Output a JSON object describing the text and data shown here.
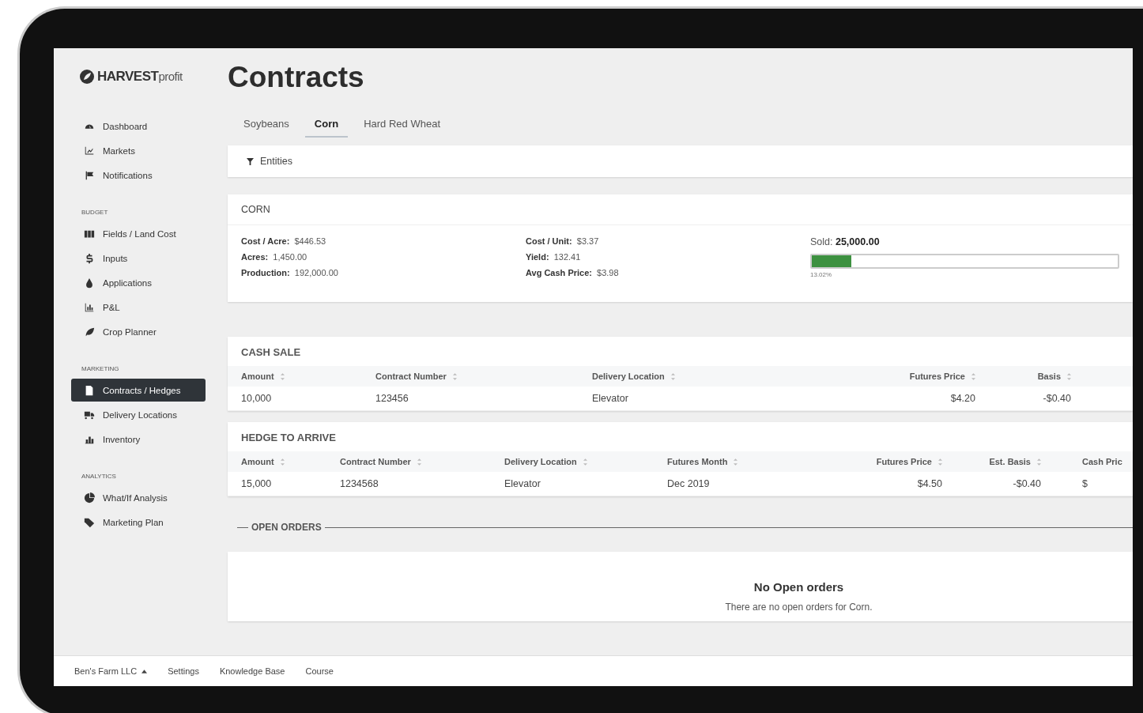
{
  "logo": {
    "brand": "HARVEST",
    "suffix": "profit"
  },
  "page_title": "Contracts",
  "sidebar": {
    "groups": [
      {
        "items": [
          {
            "label": "Dashboard",
            "selected": false
          },
          {
            "label": "Markets",
            "selected": false
          },
          {
            "label": "Notifications",
            "selected": false
          }
        ]
      },
      {
        "heading": "BUDGET",
        "items": [
          {
            "label": "Fields / Land Cost",
            "selected": false
          },
          {
            "label": "Inputs",
            "selected": false
          },
          {
            "label": "Applications",
            "selected": false
          },
          {
            "label": "P&L",
            "selected": false
          },
          {
            "label": "Crop Planner",
            "selected": false
          }
        ]
      },
      {
        "heading": "MARKETING",
        "items": [
          {
            "label": "Contracts / Hedges",
            "selected": true
          },
          {
            "label": "Delivery Locations",
            "selected": false
          },
          {
            "label": "Inventory",
            "selected": false
          }
        ]
      },
      {
        "heading": "ANALYTICS",
        "items": [
          {
            "label": "What/If Analysis",
            "selected": false
          },
          {
            "label": "Marketing Plan",
            "selected": false
          }
        ]
      }
    ]
  },
  "tabs": [
    {
      "label": "Soybeans",
      "selected": false
    },
    {
      "label": "Corn",
      "selected": true
    },
    {
      "label": "Hard Red Wheat",
      "selected": false
    }
  ],
  "filter": {
    "label": "Entities"
  },
  "summary": {
    "title": "CORN",
    "stats_left": [
      {
        "label": "Cost / Acre:",
        "value": "$446.53"
      },
      {
        "label": "Acres:",
        "value": "1,450.00"
      },
      {
        "label": "Production:",
        "value": "192,000.00"
      }
    ],
    "stats_right": [
      {
        "label": "Cost / Unit:",
        "value": "$3.37"
      },
      {
        "label": "Yield:",
        "value": "132.41"
      },
      {
        "label": "Avg Cash Price:",
        "value": "$3.98"
      }
    ],
    "sold_label": "Sold:",
    "sold_value": "25,000.00",
    "level": 0.1302,
    "percent": "13.02%"
  },
  "tables": [
    {
      "kind": "cash",
      "title": "CASH SALE",
      "columns": [
        "Amount",
        "Contract Number",
        "Delivery Location",
        "Futures Price",
        "Basis"
      ],
      "rows": [
        [
          "10,000",
          "123456",
          "Elevator",
          "$4.20",
          "-$0.40"
        ]
      ]
    },
    {
      "kind": "hedge",
      "title": "HEDGE TO ARRIVE",
      "columns": [
        "Amount",
        "Contract Number",
        "Delivery Location",
        "Futures Month",
        "Futures Price",
        "Est. Basis",
        "Cash Pric"
      ],
      "rows": [
        [
          "15,000",
          "1234568",
          "Elevator",
          "Dec 2019",
          "$4.50",
          "-$0.40",
          "$"
        ]
      ]
    }
  ],
  "open_orders": {
    "heading": "OPEN ORDERS",
    "empty_title": "No Open orders",
    "empty_text": "There are no open orders for Corn."
  },
  "footer": {
    "account": "Ben's Farm LLC",
    "links": [
      "Settings",
      "Knowledge Base",
      "Course"
    ]
  }
}
